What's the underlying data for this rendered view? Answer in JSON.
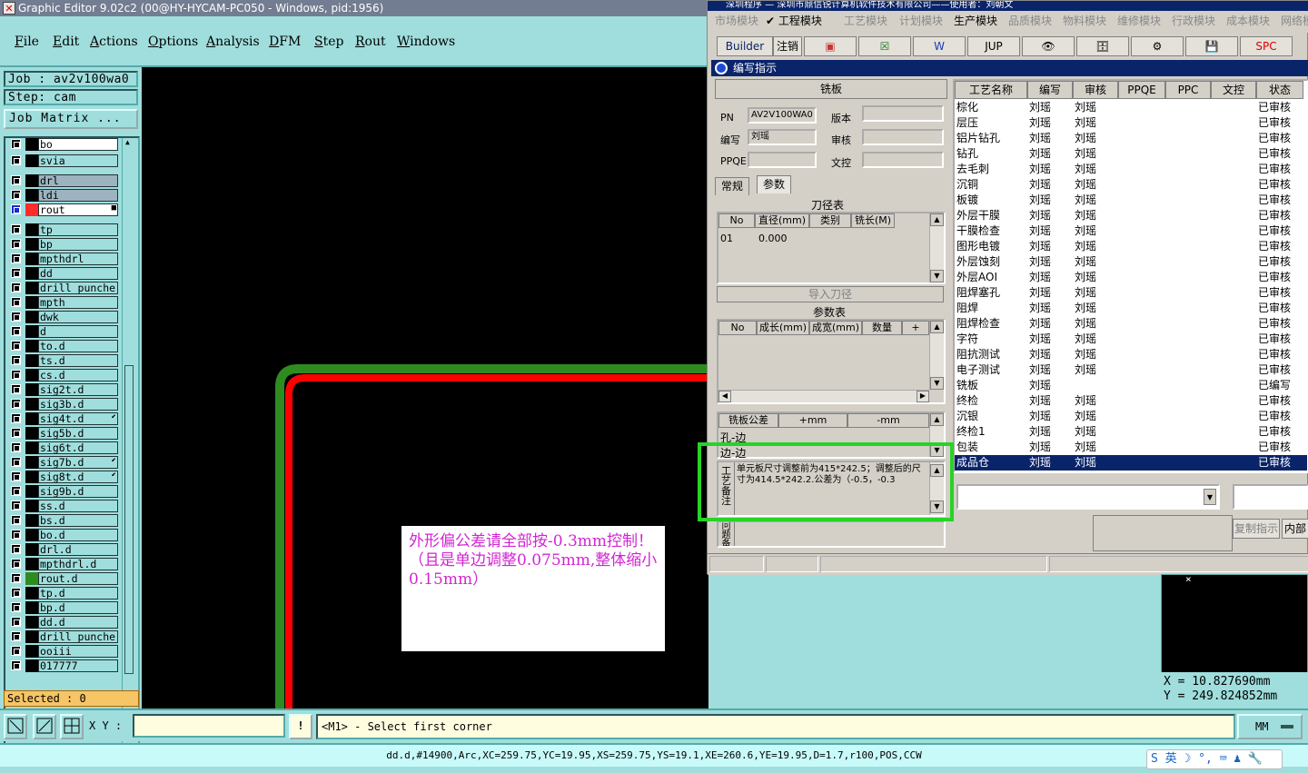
{
  "app": {
    "title": "Graphic Editor 9.02c2 (00@HY-HYCAM-PC050 - Windows, pid:1956)"
  },
  "menu": [
    "File",
    "Edit",
    "Actions",
    "Options",
    "Analysis",
    "DFM",
    "Step",
    "Rout",
    "Windows"
  ],
  "job": {
    "job_label": "Job : av2v100wa0",
    "step_label": "Step: cam",
    "matrix_button": "Job Matrix ..."
  },
  "layers": [
    {
      "name": "bo",
      "swatch": "#000000",
      "bg": "#ffffff"
    },
    {
      "name": "svia",
      "swatch": "#000000"
    },
    {
      "name": "drl",
      "swatch": "#000000",
      "bg": "#9db3c0"
    },
    {
      "name": "ldi",
      "swatch": "#000000",
      "bg": "#9db3c0"
    },
    {
      "name": "rout",
      "swatch": "#ff2a2a",
      "bg": "#ffffff",
      "checked": true,
      "mark": "■"
    },
    {
      "name": "tp",
      "swatch": "#000000"
    },
    {
      "name": "bp",
      "swatch": "#000000"
    },
    {
      "name": "mpthdrl",
      "swatch": "#000000"
    },
    {
      "name": "dd",
      "swatch": "#000000"
    },
    {
      "name": "drill_punche",
      "swatch": "#000000"
    },
    {
      "name": "mpth",
      "swatch": "#000000"
    },
    {
      "name": "dwk",
      "swatch": "#000000"
    },
    {
      "name": "d",
      "swatch": "#000000"
    },
    {
      "name": "to.d",
      "swatch": "#000000"
    },
    {
      "name": "ts.d",
      "swatch": "#000000"
    },
    {
      "name": "cs.d",
      "swatch": "#000000"
    },
    {
      "name": "sig2t.d",
      "swatch": "#000000"
    },
    {
      "name": "sig3b.d",
      "swatch": "#000000"
    },
    {
      "name": "sig4t.d",
      "swatch": "#000000",
      "mark": "⬋"
    },
    {
      "name": "sig5b.d",
      "swatch": "#000000"
    },
    {
      "name": "sig6t.d",
      "swatch": "#000000"
    },
    {
      "name": "sig7b.d",
      "swatch": "#000000",
      "mark": "⬋"
    },
    {
      "name": "sig8t.d",
      "swatch": "#000000",
      "mark": "⬋"
    },
    {
      "name": "sig9b.d",
      "swatch": "#000000"
    },
    {
      "name": "ss.d",
      "swatch": "#000000"
    },
    {
      "name": "bs.d",
      "swatch": "#000000"
    },
    {
      "name": "bo.d",
      "swatch": "#000000"
    },
    {
      "name": "drl.d",
      "swatch": "#000000"
    },
    {
      "name": "mpthdrl.d",
      "swatch": "#000000"
    },
    {
      "name": "rout.d",
      "swatch": "#2e8b20"
    },
    {
      "name": "tp.d",
      "swatch": "#000000"
    },
    {
      "name": "bp.d",
      "swatch": "#000000"
    },
    {
      "name": "dd.d",
      "swatch": "#000000"
    },
    {
      "name": "drill_punche",
      "swatch": "#000000"
    },
    {
      "name": "ooiii",
      "swatch": "#000000"
    },
    {
      "name": "017777",
      "swatch": "#000000"
    }
  ],
  "selected_label": "Selected : 0",
  "canvas": {
    "note": "外形偏公差请全部按-0.3mm控制！（且是单边调整0.075mm,整体缩小0.15mm）",
    "green_color": "#2e8b20",
    "red_color": "#ff0000"
  },
  "bottom": {
    "xy_label": "X Y :",
    "xy_value": "",
    "prompt": "<M1> - Select first corner",
    "units": "MM"
  },
  "statusline": "dd.d,#14900,Arc,XC=259.75,YC=19.95,XS=259.75,YS=19.1,XE=260.6,YE=19.95,D=1.7,r100,POS,CCW",
  "coords": {
    "x": "X  =  10.827690mm",
    "y": "Y  =  249.824852mm"
  },
  "ime": "S 英 ☽ °, ⌨ ♟ 🔧",
  "win": {
    "title": "深圳程序 — 深圳市鼎信锐计算机软件技术有限公司——使用者：刘朝文",
    "modules": [
      "市场模块",
      "✔ 工程模块",
      "工艺模块",
      "计划模块",
      "生产模块",
      "品质模块",
      "物料模块",
      "维修模块",
      "行政模块",
      "成本模块",
      "网络模"
    ],
    "toolbar": [
      "Builder",
      "注销",
      "▣",
      "☒",
      "W",
      "JUP",
      "👁",
      "🗄",
      "⚙",
      "💾",
      "SPC"
    ],
    "inner_title": "编写指示",
    "section": "铣板",
    "pn_label": "PN",
    "pn": "AV2V100WA0",
    "version_label": "版本",
    "version": "",
    "author_label": "编写",
    "author": "刘瑶",
    "review_label": "审核",
    "review": "",
    "ppqe_label": "PPQE",
    "ppqe": "",
    "dc_label": "文控",
    "dc": "",
    "tabs": [
      "常规",
      "参数"
    ],
    "tool_table_title": "刀径表",
    "tool_cols": [
      "No",
      "直径(mm)",
      "类别",
      "铣长(M)"
    ],
    "tool_rows": [
      [
        "01",
        "0.000",
        "",
        ""
      ]
    ],
    "import_btn": "导入刀径",
    "param_title": "参数表",
    "param_cols": [
      "No",
      "成长(mm)",
      "成宽(mm)",
      "数量",
      "+"
    ],
    "tol_cols": [
      "铣板公差",
      "+mm",
      "-mm"
    ],
    "tol_rows": [
      "孔-边",
      "边-边"
    ],
    "remark_label": "工艺备注",
    "remark": "单元板尺寸调整前为415*242.5；调整后的尺寸为414.5*242.2.公差为（-0.5，-0.3",
    "extra_label": "问题备注",
    "copy_btn": "复制指示",
    "inner_btn": "内部"
  },
  "proc": {
    "cols": [
      "工艺名称",
      "编写",
      "审核",
      "PPQE",
      "PPC",
      "文控",
      "状态"
    ],
    "rows": [
      [
        "棕化",
        "刘瑶",
        "刘瑶",
        "",
        "",
        "",
        "已审核"
      ],
      [
        "层压",
        "刘瑶",
        "刘瑶",
        "",
        "",
        "",
        "已审核"
      ],
      [
        "铝片钻孔",
        "刘瑶",
        "刘瑶",
        "",
        "",
        "",
        "已审核"
      ],
      [
        "钻孔",
        "刘瑶",
        "刘瑶",
        "",
        "",
        "",
        "已审核"
      ],
      [
        "去毛刺",
        "刘瑶",
        "刘瑶",
        "",
        "",
        "",
        "已审核"
      ],
      [
        "沉铜",
        "刘瑶",
        "刘瑶",
        "",
        "",
        "",
        "已审核"
      ],
      [
        "板镀",
        "刘瑶",
        "刘瑶",
        "",
        "",
        "",
        "已审核"
      ],
      [
        "外层干膜",
        "刘瑶",
        "刘瑶",
        "",
        "",
        "",
        "已审核"
      ],
      [
        "干膜检查",
        "刘瑶",
        "刘瑶",
        "",
        "",
        "",
        "已审核"
      ],
      [
        "图形电镀",
        "刘瑶",
        "刘瑶",
        "",
        "",
        "",
        "已审核"
      ],
      [
        "外层蚀刻",
        "刘瑶",
        "刘瑶",
        "",
        "",
        "",
        "已审核"
      ],
      [
        "外层AOI",
        "刘瑶",
        "刘瑶",
        "",
        "",
        "",
        "已审核"
      ],
      [
        "阻焊塞孔",
        "刘瑶",
        "刘瑶",
        "",
        "",
        "",
        "已审核"
      ],
      [
        "阻焊",
        "刘瑶",
        "刘瑶",
        "",
        "",
        "",
        "已审核"
      ],
      [
        "阻焊检查",
        "刘瑶",
        "刘瑶",
        "",
        "",
        "",
        "已审核"
      ],
      [
        "字符",
        "刘瑶",
        "刘瑶",
        "",
        "",
        "",
        "已审核"
      ],
      [
        "阻抗测试",
        "刘瑶",
        "刘瑶",
        "",
        "",
        "",
        "已审核"
      ],
      [
        "电子测试",
        "刘瑶",
        "刘瑶",
        "",
        "",
        "",
        "已审核"
      ],
      [
        "铣板",
        "刘瑶",
        "",
        "",
        "",
        "",
        "已编写"
      ],
      [
        "终检",
        "刘瑶",
        "刘瑶",
        "",
        "",
        "",
        "已审核"
      ],
      [
        "沉银",
        "刘瑶",
        "刘瑶",
        "",
        "",
        "",
        "已审核"
      ],
      [
        "终检1",
        "刘瑶",
        "刘瑶",
        "",
        "",
        "",
        "已审核"
      ],
      [
        "包装",
        "刘瑶",
        "刘瑶",
        "",
        "",
        "",
        "已审核"
      ],
      [
        "成品仓",
        "刘瑶",
        "刘瑶",
        "",
        "",
        "",
        "已审核"
      ]
    ],
    "selected_row": 23
  }
}
